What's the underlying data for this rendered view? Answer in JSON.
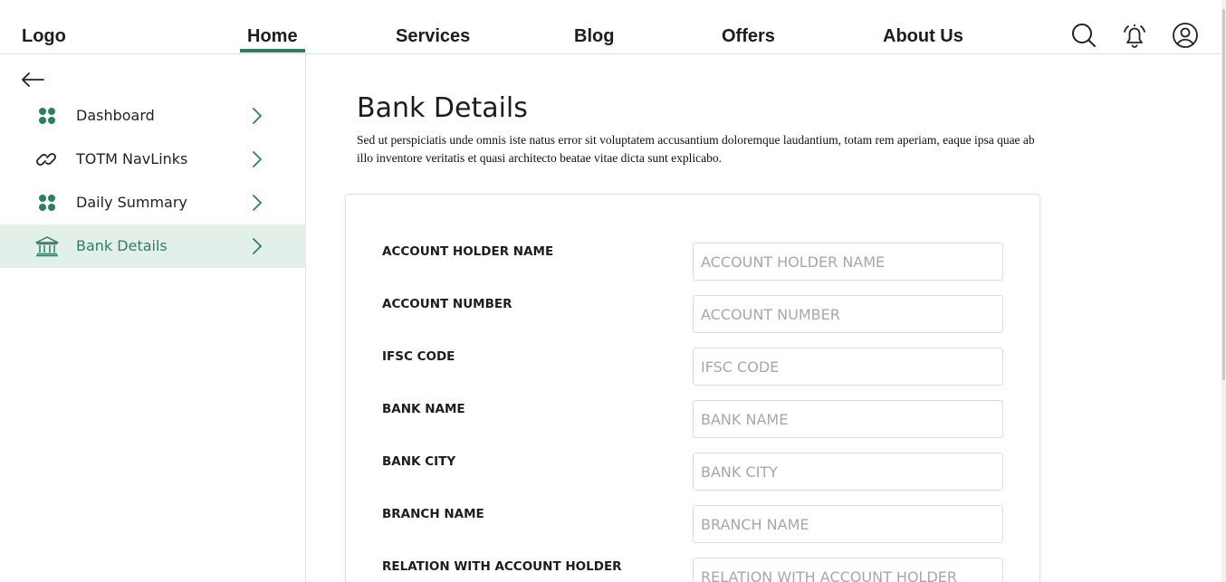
{
  "header": {
    "logo": "Logo",
    "nav": [
      "Home",
      "Services",
      "Blog",
      "Offers",
      "About Us"
    ],
    "active_nav": "Home",
    "icons": [
      "search-icon",
      "bell-icon",
      "user-icon"
    ]
  },
  "sidebar": {
    "back_icon": "back-arrow-icon",
    "items": [
      {
        "label": "Dashboard",
        "icon": "dashboard-icon",
        "active": false
      },
      {
        "label": "TOTM NavLinks",
        "icon": "link-icon",
        "active": false
      },
      {
        "label": "Daily Summary",
        "icon": "dashboard-icon",
        "active": false
      },
      {
        "label": "Bank Details",
        "icon": "bank-icon",
        "active": true
      }
    ]
  },
  "main": {
    "title": "Bank Details",
    "description": "Sed ut perspiciatis unde omnis iste natus error sit voluptatem accusantium doloremque laudantium, totam rem aperiam, eaque ipsa quae ab illo inventore veritatis et quasi architecto beatae vitae dicta sunt explicabo.",
    "fields": [
      {
        "label": "ACCOUNT HOLDER NAME",
        "placeholder": "ACCOUNT HOLDER NAME",
        "value": ""
      },
      {
        "label": "ACCOUNT NUMBER",
        "placeholder": "ACCOUNT NUMBER",
        "value": ""
      },
      {
        "label": "IFSC CODE",
        "placeholder": "IFSC CODE",
        "value": ""
      },
      {
        "label": "BANK NAME",
        "placeholder": "BANK NAME",
        "value": ""
      },
      {
        "label": "BANK CITY",
        "placeholder": "BANK CITY",
        "value": ""
      },
      {
        "label": "BRANCH NAME",
        "placeholder": "BRANCH NAME",
        "value": ""
      },
      {
        "label": "RELATION WITH ACCOUNT HOLDER",
        "placeholder": "RELATION WITH ACCOUNT HOLDER",
        "value": ""
      }
    ]
  },
  "colors": {
    "accent": "#2f7f5f",
    "active_bg": "#e3efe9",
    "text": "#1d1d1d",
    "placeholder": "#a7a7a7"
  }
}
